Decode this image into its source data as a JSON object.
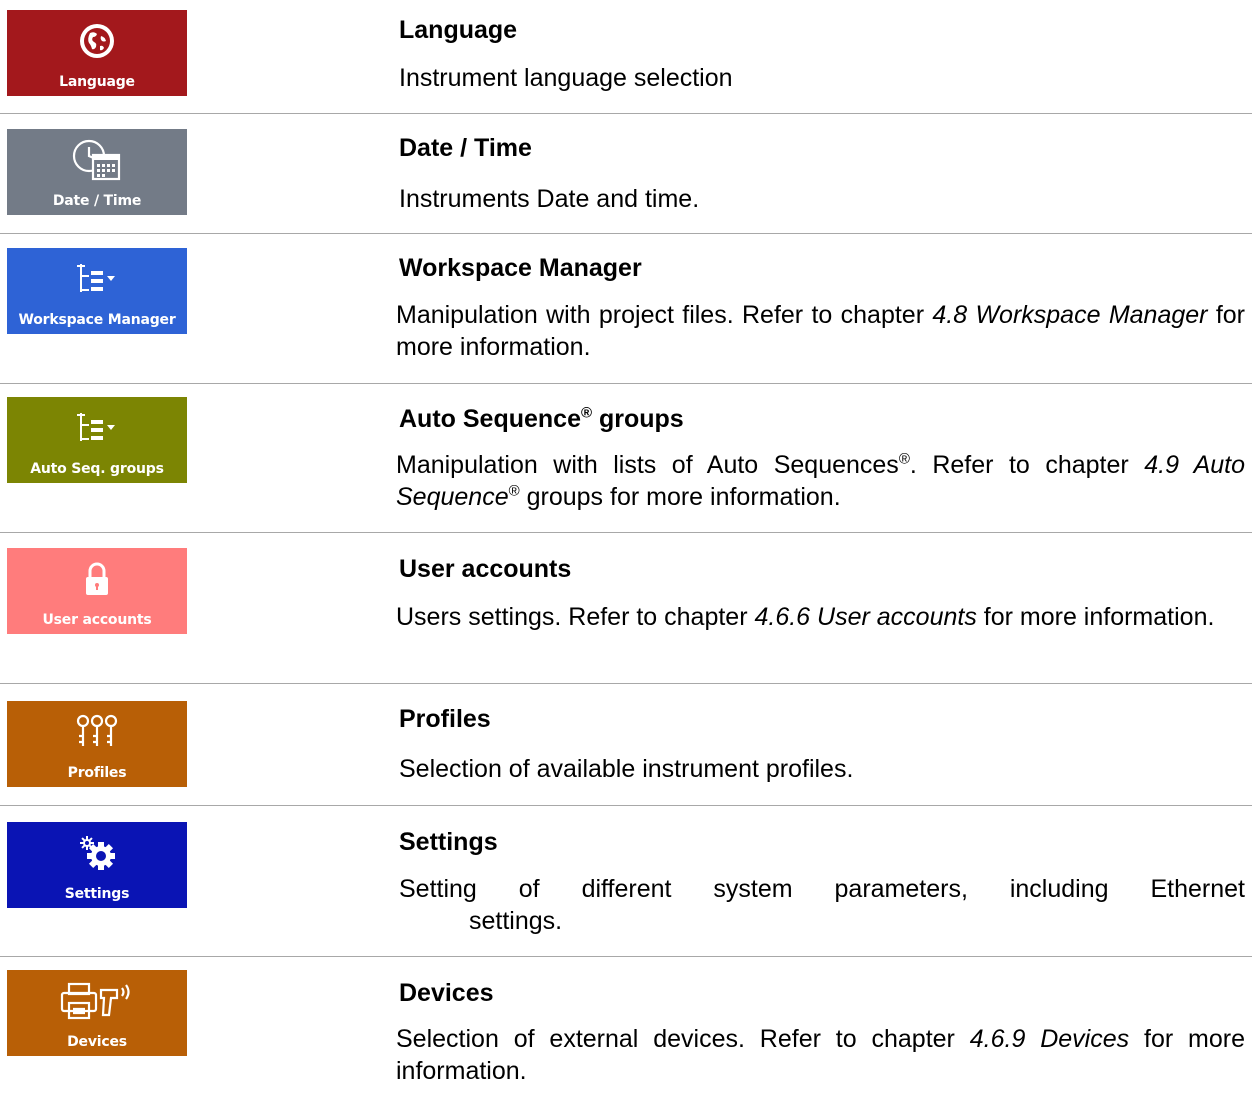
{
  "colors": {
    "language": "#a3181c",
    "datetime": "#737b87",
    "workspace": "#2e63d6",
    "autoseq": "#7c8503",
    "users": "#ff7c7c",
    "profiles": "#b85f06",
    "settings": "#0a14b4",
    "devices": "#b85f06",
    "divider": "#a8a8a8"
  },
  "items": [
    {
      "tile_label": "Language",
      "icon": "globe-icon",
      "title": "Language",
      "desc": "Instrument language selection"
    },
    {
      "tile_label": "Date / Time",
      "icon": "clock-calendar-icon",
      "title": "Date / Time",
      "desc": "Instruments Date and time."
    },
    {
      "tile_label": "Workspace Manager",
      "icon": "tree-list-icon",
      "title": "Workspace Manager",
      "desc_pre": "Manipulation with project files. Refer to chapter ",
      "desc_ref": "4.8 Workspace Manager",
      "desc_post": " for more information."
    },
    {
      "tile_label": "Auto Seq. groups",
      "icon": "tree-list-icon",
      "title_pre": "Auto Sequence",
      "title_sup": "®",
      "title_post": " groups",
      "desc_pre": "Manipulation with lists of Auto Sequences",
      "desc_sup": "®",
      "desc_mid": ". Refer to chapter ",
      "desc_ref": "4.9 Auto Sequence",
      "desc_ref_sup": "®",
      "desc_post": " groups for more information."
    },
    {
      "tile_label": "User accounts",
      "icon": "lock-icon",
      "title": "User accounts",
      "desc_pre": "Users settings. Refer to chapter ",
      "desc_ref": "4.6.6 User accounts",
      "desc_post": " for more information."
    },
    {
      "tile_label": "Profiles",
      "icon": "keys-icon",
      "title": "Profiles",
      "desc": "Selection of available instrument profiles."
    },
    {
      "tile_label": "Settings",
      "icon": "gears-icon",
      "title": "Settings",
      "desc_line1": "Setting of different system parameters, including Ethernet",
      "desc_line2": "settings."
    },
    {
      "tile_label": "Devices",
      "icon": "printer-scanner-icon",
      "title": "Devices",
      "desc_pre": "Selection of external devices. Refer to chapter ",
      "desc_ref": "4.6.9 Devices",
      "desc_post": " for more information."
    }
  ]
}
